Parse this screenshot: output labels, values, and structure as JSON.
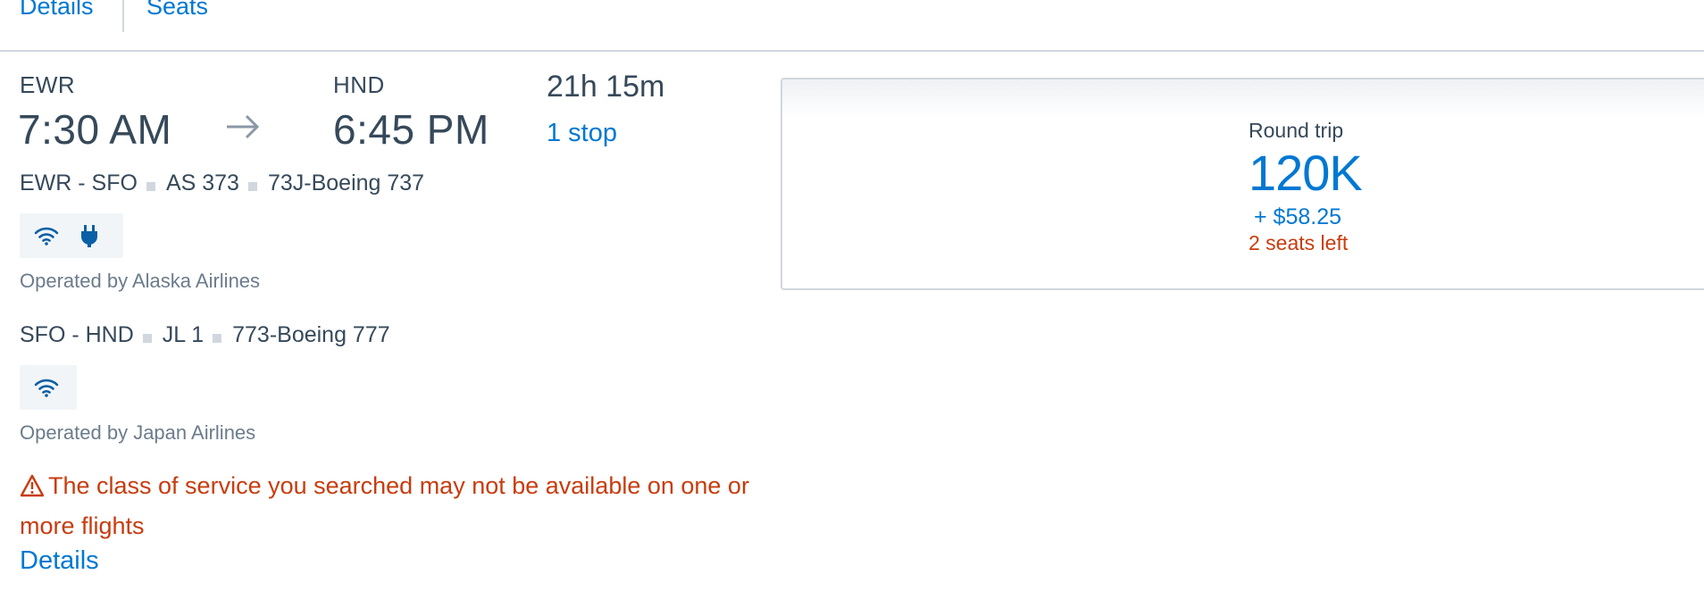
{
  "tabs": [
    {
      "label": "Details"
    },
    {
      "label": "Seats"
    }
  ],
  "summary": {
    "origin_code": "EWR",
    "origin_time": "7:30 AM",
    "destination_code": "HND",
    "destination_time": "6:45 PM",
    "duration": "21h 15m",
    "stops": "1 stop"
  },
  "segments": [
    {
      "route": "EWR - SFO",
      "flight": "AS 373",
      "aircraft": "73J-Boeing 737",
      "amenities": [
        "wifi-icon",
        "power-outlet-icon"
      ],
      "operated_by": "Operated by Alaska Airlines"
    },
    {
      "route": "SFO - HND",
      "flight": "JL 1",
      "aircraft": "773-Boeing 777",
      "amenities": [
        "wifi-icon"
      ],
      "operated_by": "Operated by Japan Airlines"
    }
  ],
  "warning": {
    "icon": "warning-triangle-icon",
    "text": "The class of service you searched may not be available on one or more flights"
  },
  "details_link": "Details",
  "fare": {
    "label": "Round trip",
    "miles": "120K",
    "taxes": "+ $58.25",
    "seats_left": "2 seats left"
  },
  "colors": {
    "link": "#0078d2",
    "text": "#36495a",
    "muted": "#6b7c8c",
    "warning": "#c83c0e",
    "border": "#d0d7de",
    "amenity_bg": "#f2f5f8",
    "icon": "#0b5fa5"
  }
}
